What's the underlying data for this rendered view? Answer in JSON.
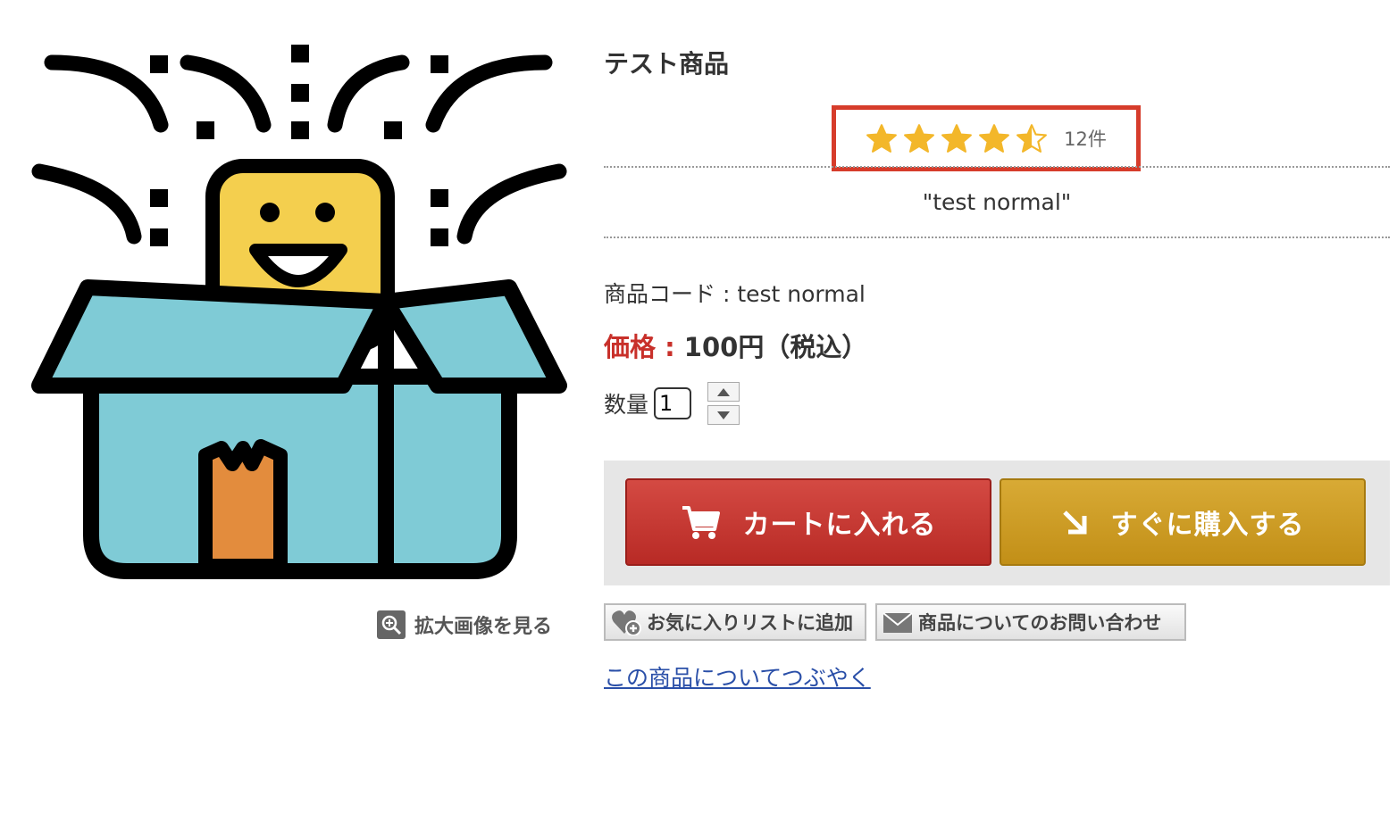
{
  "product": {
    "title": "テスト商品",
    "subtitle": "\"test normal\"",
    "code_label": "商品コード : test normal",
    "price_label": "価格 : ",
    "price_value": "100円（税込）",
    "quantity_label": "数量",
    "quantity_value": "1",
    "zoom_label": "拡大画像を見る"
  },
  "rating": {
    "score": 4.5,
    "max": 5,
    "count_label": "12件",
    "star_color": "#f3b72a",
    "box_color": "#d63c2b"
  },
  "buttons": {
    "add_to_cart": "カートに入れる",
    "buy_now": "すぐに購入する",
    "add_favorite": "お気に入りリストに追加",
    "inquiry": "商品についてのお問い合わせ",
    "tweet": "この商品についてつぶやく"
  },
  "colors": {
    "price_red": "#c8302a",
    "cart_red": "#c0332e",
    "buy_gold": "#cc9a22",
    "link_blue": "#2a4fa8"
  },
  "icons": {
    "cart": "cart-icon",
    "buy": "arrow-down-right-icon",
    "favorite": "heart-plus-icon",
    "inquiry": "envelope-icon",
    "zoom": "magnify-plus-icon",
    "product": "surprise-box-icon"
  }
}
